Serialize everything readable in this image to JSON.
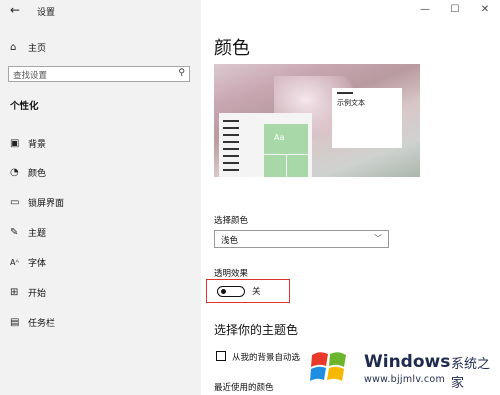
{
  "window": {
    "title": "设置",
    "back_glyph": "←",
    "controls": {
      "minimize": "—",
      "maximize": "☐",
      "close": "✕"
    }
  },
  "sidebar": {
    "home_label": "主页",
    "search_placeholder": "查找设置",
    "section_title": "个性化",
    "items": [
      {
        "label": "背景",
        "icon": "background-icon"
      },
      {
        "label": "颜色",
        "icon": "palette-icon"
      },
      {
        "label": "锁屏界面",
        "icon": "lock-screen-icon"
      },
      {
        "label": "主题",
        "icon": "theme-icon"
      },
      {
        "label": "字体",
        "icon": "font-icon"
      },
      {
        "label": "开始",
        "icon": "start-icon"
      },
      {
        "label": "任务栏",
        "icon": "taskbar-icon"
      }
    ]
  },
  "main": {
    "title": "颜色",
    "preview": {
      "tile_text": "Aa",
      "dialog_text": "示例文本"
    },
    "choose_color_label": "选择颜色",
    "choose_color_value": "浅色",
    "transparency_label": "透明效果",
    "transparency_state": "关",
    "accent_title": "选择你的主题色",
    "auto_accent_label": "从我的背景自动选",
    "recent_colors_label": "最近使用的颜色",
    "colors": {
      "tile_green": "#a8d8a8",
      "highlight_red": "#e0342b"
    }
  },
  "watermark": {
    "brand": "Windows",
    "cn": "系统之家",
    "url": "www.bjjmlv.com"
  }
}
